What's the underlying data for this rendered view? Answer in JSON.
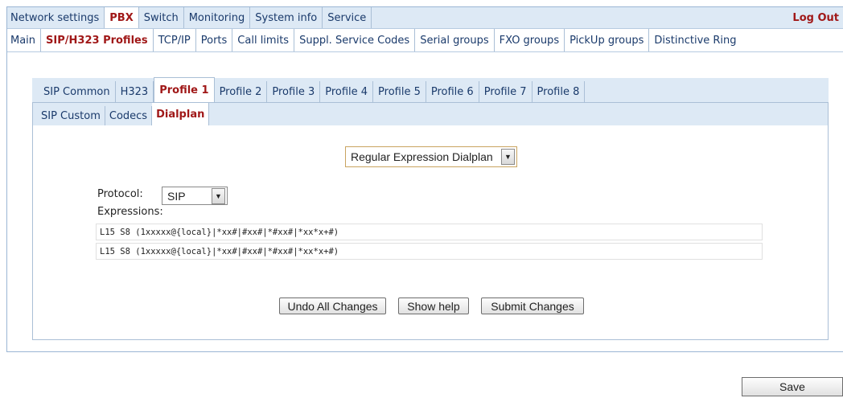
{
  "top_nav": {
    "tabs": [
      {
        "label": "Network settings",
        "active": false
      },
      {
        "label": "PBX",
        "active": true
      },
      {
        "label": "Switch",
        "active": false
      },
      {
        "label": "Monitoring",
        "active": false
      },
      {
        "label": "System info",
        "active": false
      },
      {
        "label": "Service",
        "active": false
      }
    ],
    "logout_label": "Log Out"
  },
  "pbx_nav": {
    "tabs": [
      {
        "label": "Main",
        "active": false
      },
      {
        "label": "SIP/H323 Profiles",
        "active": true
      },
      {
        "label": "TCP/IP",
        "active": false
      },
      {
        "label": "Ports",
        "active": false
      },
      {
        "label": "Call limits",
        "active": false
      },
      {
        "label": "Suppl. Service Codes",
        "active": false
      },
      {
        "label": "Serial groups",
        "active": false
      },
      {
        "label": "FXO groups",
        "active": false
      },
      {
        "label": "PickUp groups",
        "active": false
      },
      {
        "label": "Distinctive Ring",
        "active": false
      }
    ]
  },
  "profile_nav": {
    "tabs": [
      {
        "label": "SIP Common",
        "active": false
      },
      {
        "label": "H323",
        "active": false
      },
      {
        "label": "Profile 1",
        "active": true
      },
      {
        "label": "Profile 2",
        "active": false
      },
      {
        "label": "Profile 3",
        "active": false
      },
      {
        "label": "Profile 4",
        "active": false
      },
      {
        "label": "Profile 5",
        "active": false
      },
      {
        "label": "Profile 6",
        "active": false
      },
      {
        "label": "Profile 7",
        "active": false
      },
      {
        "label": "Profile 8",
        "active": false
      }
    ]
  },
  "sub_nav": {
    "tabs": [
      {
        "label": "SIP Custom",
        "active": false
      },
      {
        "label": "Codecs",
        "active": false
      },
      {
        "label": "Dialplan",
        "active": true
      }
    ]
  },
  "dialplan": {
    "mode_value": "Regular Expression Dialplan",
    "protocol_label": "Protocol:",
    "protocol_value": "SIP",
    "expressions_label": "Expressions:",
    "expressions": [
      "L15 S8  (1xxxxx@{local}|*xx#|#xx#|*#xx#|*xx*x+#)",
      "L15 S8  (1xxxxx@{local}|*xx#|#xx#|*#xx#|*xx*x+#)"
    ]
  },
  "buttons": {
    "undo": "Undo All Changes",
    "help": "Show help",
    "submit": "Submit Changes",
    "save": "Save"
  },
  "colors": {
    "active_tab_text": "#a01818",
    "tab_text": "#1a3a6b",
    "bar_bg": "#dde9f5",
    "border": "#aabfd6"
  }
}
